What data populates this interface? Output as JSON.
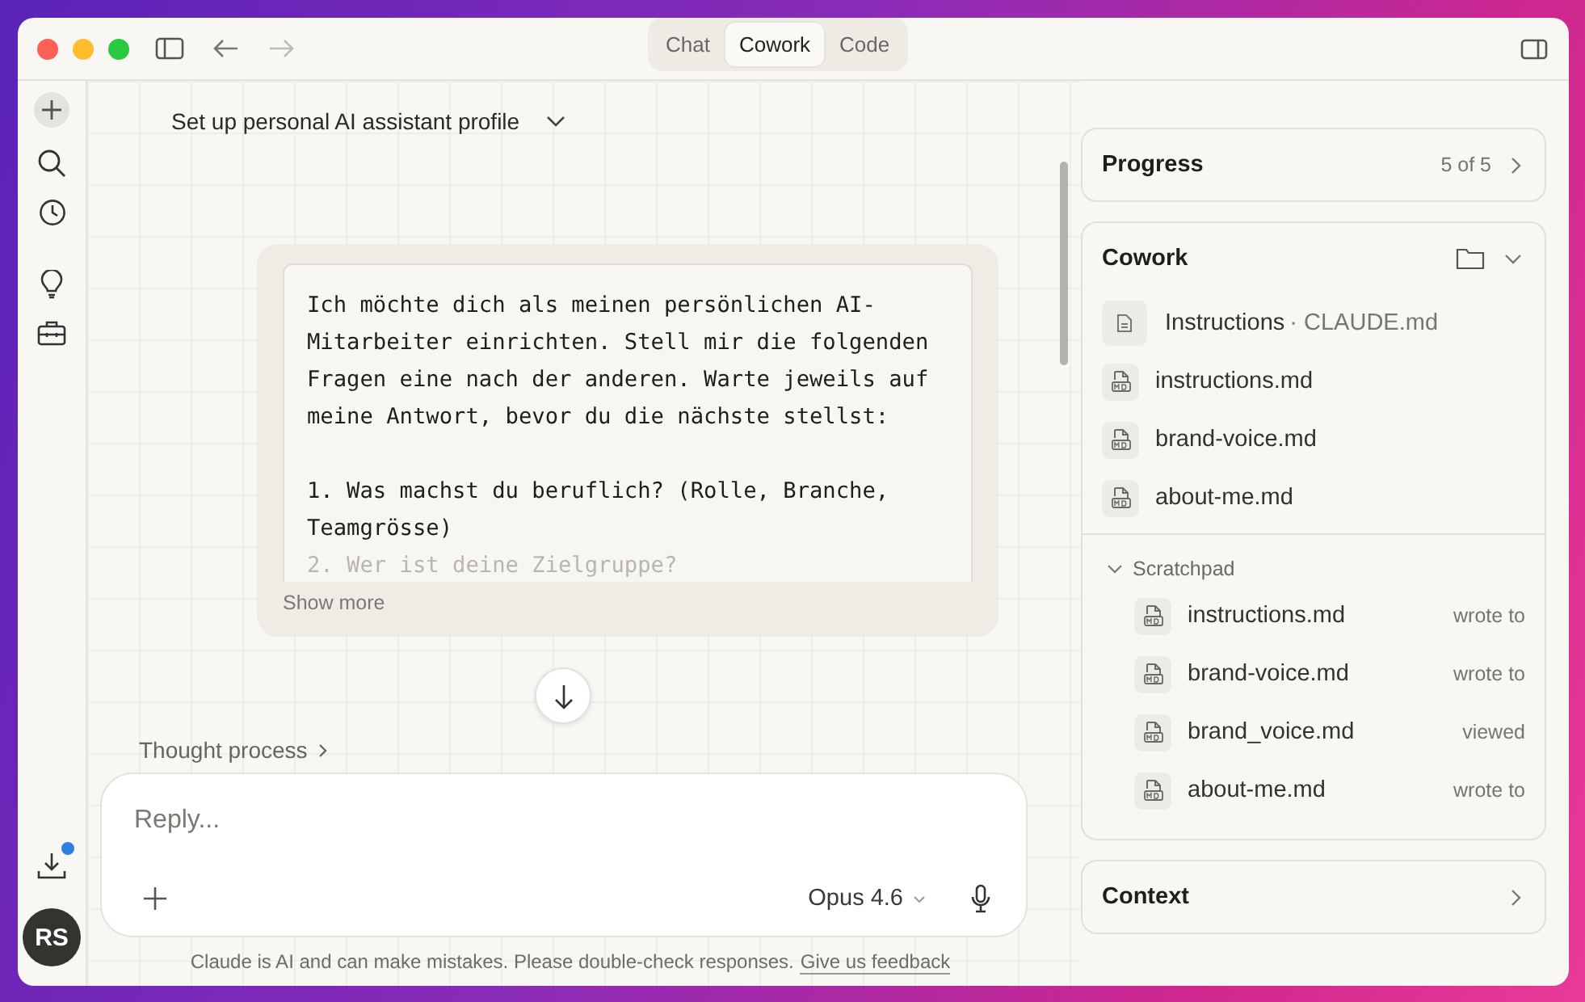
{
  "window": {
    "tabs": [
      {
        "label": "Chat",
        "selected": false
      },
      {
        "label": "Cowork",
        "selected": true
      },
      {
        "label": "Code",
        "selected": false
      }
    ]
  },
  "sidebar": {
    "download_badge": true,
    "avatar": "RS"
  },
  "conversation": {
    "title": "Set up personal AI assistant profile",
    "message": {
      "paragraph": "Ich möchte dich als meinen persönlichen AI-Mitarbeiter einrichten. Stell mir die folgenden Fragen eine nach der anderen. Warte jeweils auf meine Antwort, bevor du die nächste stellst:",
      "list": [
        {
          "text": "1. Was machst du beruflich? (Rolle, Branche, Teamgrösse)",
          "faded": false
        },
        {
          "text": "2. Wer ist deine Zielgruppe?",
          "faded": true
        }
      ],
      "show_more": "Show more"
    },
    "thought_process": "Thought process"
  },
  "composer": {
    "placeholder": "Reply...",
    "model": "Opus 4.6"
  },
  "disclaimer": {
    "text": "Claude is AI and can make mistakes. Please double-check responses.",
    "link": "Give us feedback"
  },
  "panel": {
    "progress": {
      "title": "Progress",
      "count": "5 of 5"
    },
    "cowork": {
      "title": "Cowork",
      "expanded": true,
      "files": [
        {
          "kind": "instructions",
          "name": "Instructions",
          "detail": "· CLAUDE.md"
        },
        {
          "kind": "md",
          "name": "instructions.md"
        },
        {
          "kind": "md",
          "name": "brand-voice.md"
        },
        {
          "kind": "md",
          "name": "about-me.md"
        }
      ],
      "scratchpad": {
        "title": "Scratchpad",
        "expanded": true,
        "files": [
          {
            "name": "instructions.md",
            "action": "wrote to"
          },
          {
            "name": "brand-voice.md",
            "action": "wrote to"
          },
          {
            "name": "brand_voice.md",
            "action": "viewed"
          },
          {
            "name": "about-me.md",
            "action": "wrote to"
          }
        ]
      }
    },
    "context": {
      "title": "Context"
    }
  }
}
